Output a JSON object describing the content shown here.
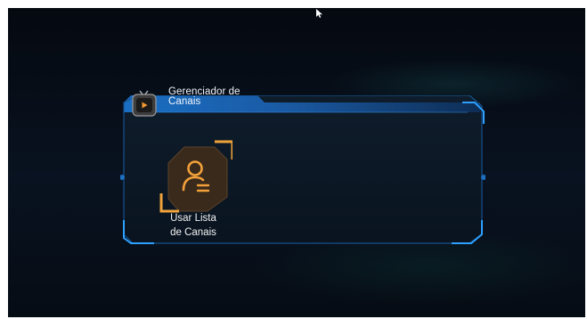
{
  "window": {
    "title": "Gerenciador de Canais",
    "title_line1": "Gerenciador de",
    "title_line2": "Canais",
    "icon": "tv-play-icon"
  },
  "items": [
    {
      "label": "Usar Lista de Canais",
      "label_line1": "Usar Lista",
      "label_line2": "de Canais",
      "icon": "user-list-icon",
      "selected": true
    }
  ],
  "colors": {
    "accent_blue": "#1e7fd8",
    "accent_orange": "#e8952a",
    "text": "#f2f6fb",
    "background": "#070d16"
  }
}
